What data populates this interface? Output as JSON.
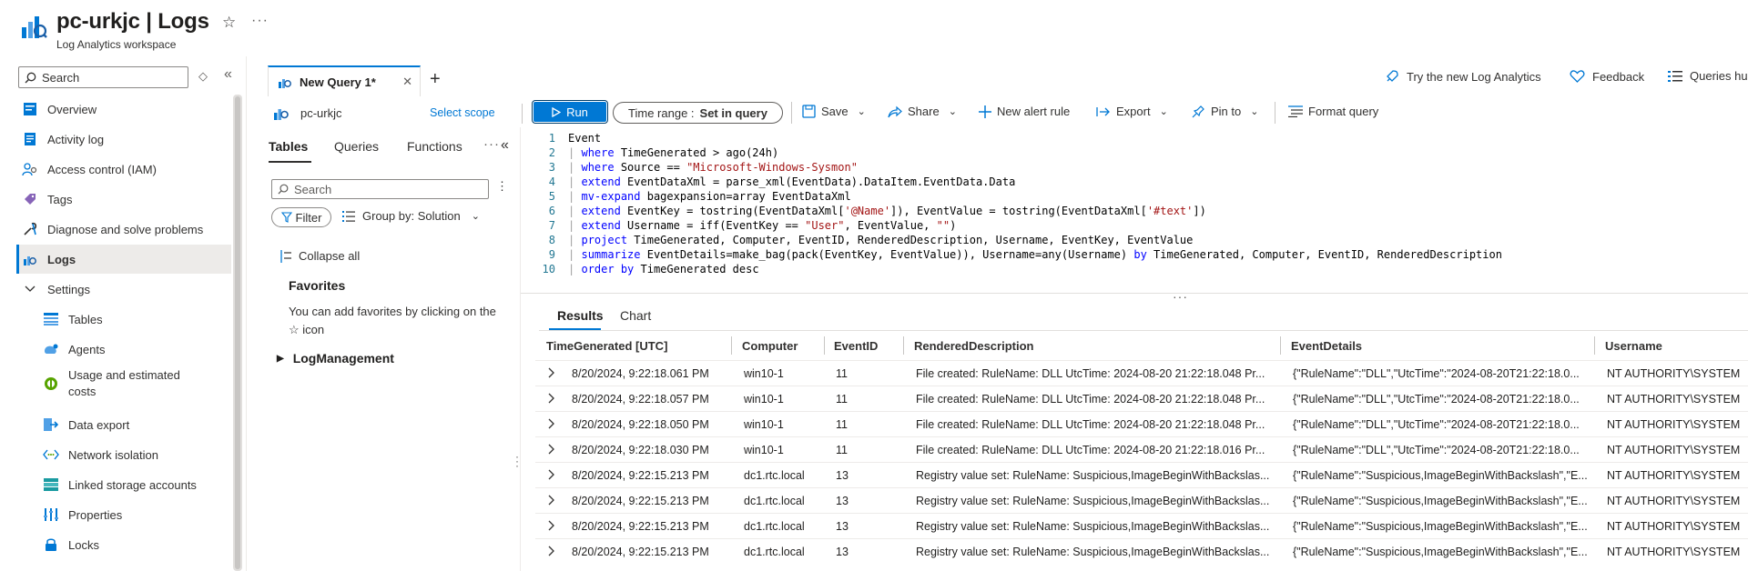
{
  "header": {
    "title": "pc-urkjc | Logs",
    "subtitle": "Log Analytics workspace",
    "more": "···"
  },
  "nav": {
    "search_placeholder": "Search",
    "items": [
      {
        "label": "Overview",
        "icon": "overview-icon"
      },
      {
        "label": "Activity log",
        "icon": "activity-log-icon"
      },
      {
        "label": "Access control (IAM)",
        "icon": "iam-icon"
      },
      {
        "label": "Tags",
        "icon": "tag-icon"
      },
      {
        "label": "Diagnose and solve problems",
        "icon": "wrench-icon"
      },
      {
        "label": "Logs",
        "icon": "logs-icon",
        "active": true
      },
      {
        "label": "Settings",
        "icon": "chevron-down-icon"
      },
      {
        "label": "Tables",
        "icon": "table-icon"
      },
      {
        "label": "Agents",
        "icon": "agents-icon"
      },
      {
        "label": "Usage and estimated",
        "label2": "costs",
        "icon": "usage-icon"
      },
      {
        "label": "Data export",
        "icon": "data-export-icon"
      },
      {
        "label": "Network isolation",
        "icon": "network-icon"
      },
      {
        "label": "Linked storage accounts",
        "icon": "storage-icon"
      },
      {
        "label": "Properties",
        "icon": "properties-icon"
      },
      {
        "label": "Locks",
        "icon": "lock-icon"
      }
    ]
  },
  "query_tab": {
    "label": "New Query 1*",
    "close": "✕",
    "add": "+"
  },
  "top_right": {
    "try_new": "Try the new Log Analytics",
    "feedback": "Feedback",
    "queries_hub": "Queries hu"
  },
  "scope": {
    "name": "pc-urkjc",
    "select_label": "Select scope"
  },
  "toolbar": {
    "run": "Run",
    "time_range_label": "Time range :",
    "time_range_value": "Set in query",
    "save": "Save",
    "share": "Share",
    "new_alert": "New alert rule",
    "export": "Export",
    "pin": "Pin to",
    "format": "Format query"
  },
  "schema": {
    "tabs": [
      "Tables",
      "Queries",
      "Functions"
    ],
    "search_placeholder": "Search",
    "filter": "Filter",
    "group_by": "Group by: Solution",
    "collapse_all": "Collapse all",
    "favorites_title": "Favorites",
    "favorites_text": "You can add favorites by clicking on the ☆ icon",
    "tree_item": "LogManagement"
  },
  "editor": {
    "lines": [
      "Event",
      "| where TimeGenerated > ago(24h)",
      "| where Source == \"Microsoft-Windows-Sysmon\"",
      "| extend EventDataXml = parse_xml(EventData).DataItem.EventData.Data",
      "| mv-expand bagexpansion=array EventDataXml",
      "| extend EventKey = tostring(EventDataXml['@Name']), EventValue = tostring(EventDataXml['#text'])",
      "| extend Username = iff(EventKey == \"User\", EventValue, \"\")",
      "| project TimeGenerated, Computer, EventID, RenderedDescription, Username, EventKey, EventValue",
      "| summarize EventDetails=make_bag(pack(EventKey, EventValue)), Username=any(Username) by TimeGenerated, Computer, EventID, RenderedDescription",
      "| order by TimeGenerated desc"
    ]
  },
  "results": {
    "tabs": [
      "Results",
      "Chart"
    ],
    "columns": [
      "TimeGenerated [UTC]",
      "Computer",
      "EventID",
      "RenderedDescription",
      "EventDetails",
      "Username"
    ],
    "rows": [
      [
        "8/20/2024, 9:22:18.061 PM",
        "win10-1",
        "11",
        "File created: RuleName: DLL UtcTime: 2024-08-20 21:22:18.048 Pr...",
        "{\"RuleName\":\"DLL\",\"UtcTime\":\"2024-08-20T21:22:18.0...",
        "NT AUTHORITY\\SYSTEM"
      ],
      [
        "8/20/2024, 9:22:18.057 PM",
        "win10-1",
        "11",
        "File created: RuleName: DLL UtcTime: 2024-08-20 21:22:18.048 Pr...",
        "{\"RuleName\":\"DLL\",\"UtcTime\":\"2024-08-20T21:22:18.0...",
        "NT AUTHORITY\\SYSTEM"
      ],
      [
        "8/20/2024, 9:22:18.050 PM",
        "win10-1",
        "11",
        "File created: RuleName: DLL UtcTime: 2024-08-20 21:22:18.048 Pr...",
        "{\"RuleName\":\"DLL\",\"UtcTime\":\"2024-08-20T21:22:18.0...",
        "NT AUTHORITY\\SYSTEM"
      ],
      [
        "8/20/2024, 9:22:18.030 PM",
        "win10-1",
        "11",
        "File created: RuleName: DLL UtcTime: 2024-08-20 21:22:18.016 Pr...",
        "{\"RuleName\":\"DLL\",\"UtcTime\":\"2024-08-20T21:22:18.0...",
        "NT AUTHORITY\\SYSTEM"
      ],
      [
        "8/20/2024, 9:22:15.213 PM",
        "dc1.rtc.local",
        "13",
        "Registry value set: RuleName: Suspicious,ImageBeginWithBackslas...",
        "{\"RuleName\":\"Suspicious,ImageBeginWithBackslash\",\"E...",
        "NT AUTHORITY\\SYSTEM"
      ],
      [
        "8/20/2024, 9:22:15.213 PM",
        "dc1.rtc.local",
        "13",
        "Registry value set: RuleName: Suspicious,ImageBeginWithBackslas...",
        "{\"RuleName\":\"Suspicious,ImageBeginWithBackslash\",\"E...",
        "NT AUTHORITY\\SYSTEM"
      ],
      [
        "8/20/2024, 9:22:15.213 PM",
        "dc1.rtc.local",
        "13",
        "Registry value set: RuleName: Suspicious,ImageBeginWithBackslas...",
        "{\"RuleName\":\"Suspicious,ImageBeginWithBackslash\",\"E...",
        "NT AUTHORITY\\SYSTEM"
      ],
      [
        "8/20/2024, 9:22:15.213 PM",
        "dc1.rtc.local",
        "13",
        "Registry value set: RuleName: Suspicious,ImageBeginWithBackslas...",
        "{\"RuleName\":\"Suspicious,ImageBeginWithBackslash\",\"E...",
        "NT AUTHORITY\\SYSTEM"
      ]
    ]
  },
  "colors": {
    "accent": "#0078d4",
    "keyword": "#0000ff",
    "string": "#a31515",
    "line_number": "#237893"
  }
}
